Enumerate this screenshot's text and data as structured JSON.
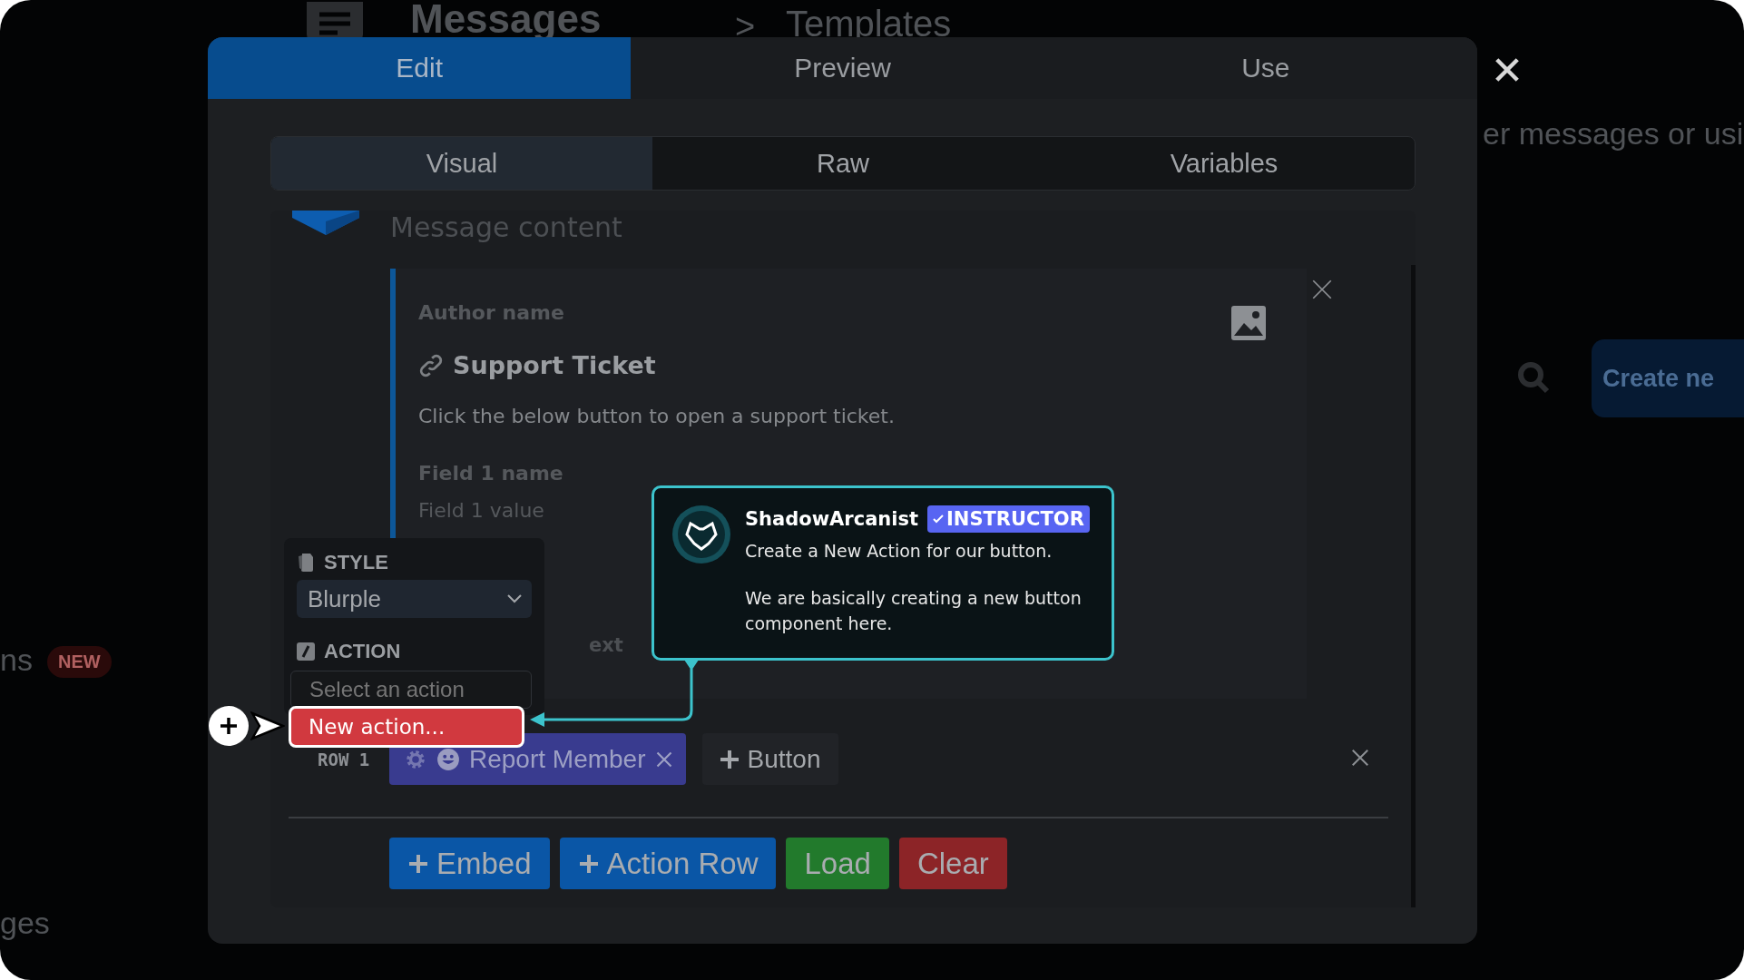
{
  "background": {
    "heading": "Messages",
    "separator": ">",
    "breadcrumb": "Templates",
    "subtitle": "er messages or usi",
    "create_button": "Create ne",
    "sidebar_items": [
      {
        "label": "ns",
        "badge": "NEW"
      },
      {
        "label": "ges"
      }
    ]
  },
  "modal": {
    "tabs": [
      {
        "label": "Edit",
        "selected": true
      },
      {
        "label": "Preview",
        "selected": false
      },
      {
        "label": "Use",
        "selected": false
      }
    ],
    "editor_tabs": [
      {
        "label": "Visual",
        "selected": true
      },
      {
        "label": "Raw",
        "selected": false
      },
      {
        "label": "Variables",
        "selected": false
      }
    ],
    "content": {
      "placeholder": "Message content"
    },
    "embed": {
      "author": "Author name",
      "title": "Support Ticket",
      "description": "Click the below button to open a support ticket.",
      "fields": [
        {
          "name": "Field 1 name",
          "value": "Field 1 value"
        }
      ],
      "footer": "ext"
    },
    "action_row": {
      "label": "ROW 1",
      "buttons": [
        {
          "label": "Report Member"
        }
      ],
      "add_button": "Button"
    },
    "toolbar": [
      {
        "label": "Embed",
        "kind": "add",
        "color": "#0a56a6"
      },
      {
        "label": "Action Row",
        "kind": "add",
        "color": "#0a56a6"
      },
      {
        "label": "Load",
        "kind": "plain",
        "color": "#227a2c"
      },
      {
        "label": "Clear",
        "kind": "plain",
        "color": "#8c2427"
      }
    ]
  },
  "button_editor": {
    "style_label": "STYLE",
    "style_value": "Blurple",
    "action_label": "ACTION",
    "action_placeholder": "Select an action",
    "options": [
      {
        "label": "New action...",
        "selected": true
      }
    ]
  },
  "tooltip": {
    "name": "ShadowArcanist",
    "badge": "INSTRUCTOR",
    "lines": [
      "Create a New Action for our button.",
      "We are basically creating a new button component here."
    ]
  }
}
